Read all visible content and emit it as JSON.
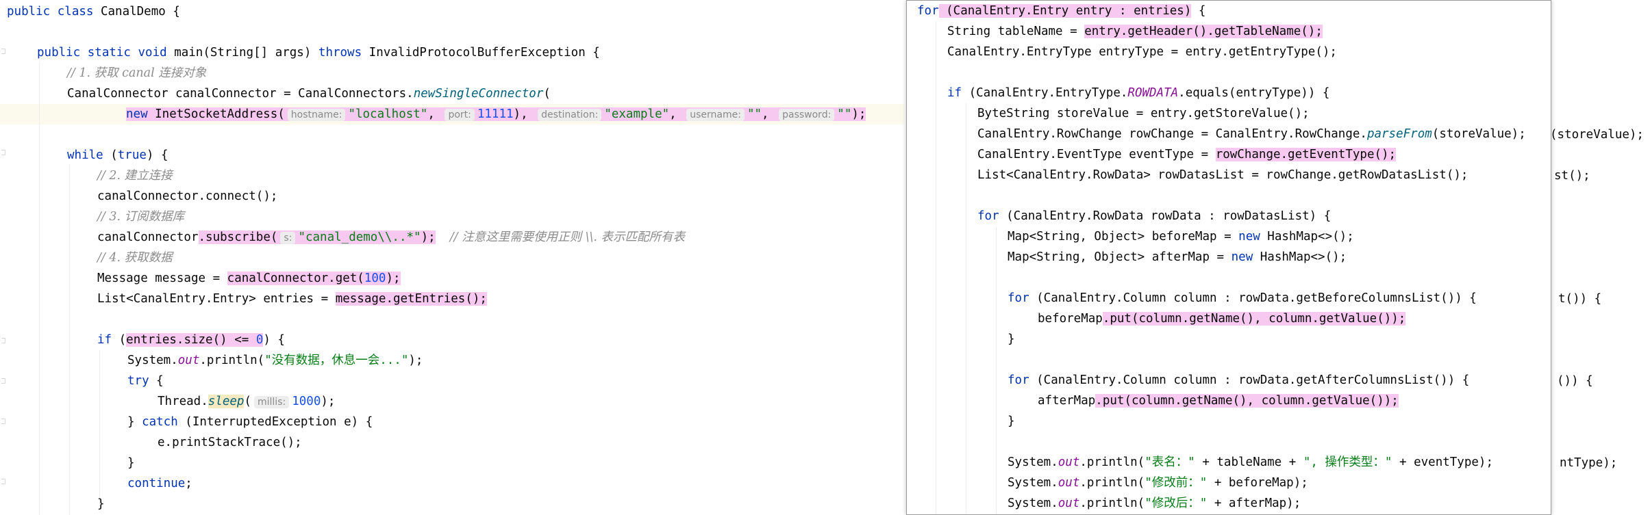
{
  "left_editor": {
    "lines": {
      "l1": {
        "a": "public class ",
        "b": "CanalDemo {"
      },
      "l2": {
        "a": "public static void ",
        "b": "main(String[] args) ",
        "c": "throws",
        "d": " InvalidProtocolBufferException {"
      },
      "l3": {
        "a": "// 1. 获取 canal 连接对象"
      },
      "l4": {
        "a": "CanalConnector canalConnector = CanalConnectors.",
        "b": "newSingleConnector",
        "c": "("
      },
      "l5": {
        "new": "new",
        "cls": " InetSocketAddress(",
        "h1": "hostname:",
        "v1": "\"localhost\"",
        "sep1": ", ",
        "h2": "port:",
        "v2": "11111",
        "sep2": "), ",
        "h3": "destination:",
        "v3": "\"example\"",
        "sep3": ", ",
        "h4": "username:",
        "v4": "\"\"",
        "sep4": ", ",
        "h5": "password:",
        "v5": "\"\"",
        "end": ");"
      },
      "l6": {
        "a": "while",
        "b": " (",
        "c": "true",
        "d": ") {"
      },
      "l7": {
        "a": "// 2. 建立连接"
      },
      "l8": {
        "a": "canalConnector.connect();"
      },
      "l9": {
        "a": "// 3. 订阅数据库"
      },
      "l10": {
        "a": "canalConnector",
        "b": ".subscribe(",
        "h": "s:",
        "v": "\"canal_demo\\\\..*\"",
        "c": ");",
        "cmt": "// 注意这里需要使用正则 \\\\. 表示匹配所有表"
      },
      "l11": {
        "a": "// 4. 获取数据"
      },
      "l12": {
        "a": "Message message = ",
        "b": "canalConnector.get(",
        "n": "100",
        "c": ");"
      },
      "l13": {
        "a": "List<CanalEntry.Entry> entries = ",
        "b": "message.getEntries();"
      },
      "l14": {
        "a": "if",
        "b": " (",
        "c": "entries.size() <= ",
        "n": "0",
        "d": ") {"
      },
      "l15": {
        "a": "System.",
        "b": "out",
        "c": ".println(",
        "s": "\"没有数据，休息一会...\"",
        "d": ");"
      },
      "l16": {
        "a": "try",
        "b": " {"
      },
      "l17": {
        "a": "Thread.",
        "b": "sleep",
        "c": "(",
        "h": "millis:",
        "n": "1000",
        "d": ");"
      },
      "l18": {
        "a": "} ",
        "b": "catch",
        "c": " (InterruptedException e) {"
      },
      "l19": {
        "a": "e.printStackTrace();"
      },
      "l20": {
        "a": "}"
      },
      "l21": {
        "a": "continue",
        "b": ";"
      },
      "l22": {
        "a": "}"
      }
    }
  },
  "popup": {
    "lines": {
      "p1": {
        "a": "for",
        "b": " (CanalEntry.Entry entry : entries)",
        "c": " {"
      },
      "p2": {
        "a": "String tableName = ",
        "b": "entry.getHeader().getTableName();"
      },
      "p3": {
        "a": "CanalEntry.EntryType entryType = entry.getEntryType();"
      },
      "p4": {
        "a": "if",
        "b": " (CanalEntry.EntryType.",
        "c": "ROWDATA",
        "d": ".equals(entryType)) {"
      },
      "p5": {
        "a": "ByteString storeValue = entry.getStoreValue();"
      },
      "p6": {
        "a": "CanalEntry.RowChange rowChange = CanalEntry.RowChange.",
        "b": "parseFrom",
        "c": "(storeValue);",
        "ghost": "(storeValue);"
      },
      "p7": {
        "a": "CanalEntry.EventType eventType = ",
        "b": "rowChange.getEventType();"
      },
      "p8": {
        "a": "List<CanalEntry.RowData> rowDatasList = rowChange.getRowDatasList();",
        "ghost": "st();"
      },
      "p9": {
        "a": "for",
        "b": " (CanalEntry.RowData rowData : rowDatasList) {"
      },
      "p10": {
        "a": "Map<String, Object> beforeMap = ",
        "b": "new",
        "c": " HashMap<>();"
      },
      "p11": {
        "a": "Map<String, Object> afterMap = ",
        "b": "new",
        "c": " HashMap<>();"
      },
      "p12": {
        "a": "for",
        "b": " (CanalEntry.Column column : rowData.getBeforeColumnsList()) {",
        "ghost": "t()) {"
      },
      "p13": {
        "a": "beforeMap",
        "b": ".put(column.getName(), column.getValue());"
      },
      "p14": {
        "a": "}"
      },
      "p15": {
        "a": "for",
        "b": " (CanalEntry.Column column : rowData.getAfterColumnsList()) {",
        "ghost": "()) {"
      },
      "p16": {
        "a": "afterMap",
        "b": ".put(column.getName(), column.getValue());"
      },
      "p17": {
        "a": "}"
      },
      "p18": {
        "a": "System.",
        "b": "out",
        "c": ".println(",
        "s1": "\"表名：\"",
        "d": " + tableName + ",
        "s2": "\", 操作类型：\"",
        "e": " + eventType);",
        "ghost": "ntType);"
      },
      "p19": {
        "a": "System.",
        "b": "out",
        "c": ".println(",
        "s": "\"修改前：\"",
        "d": " + beforeMap);"
      },
      "p20": {
        "a": "System.",
        "b": "out",
        "c": ".println(",
        "s": "\"修改后：\"",
        "d": " + afterMap);"
      }
    }
  }
}
